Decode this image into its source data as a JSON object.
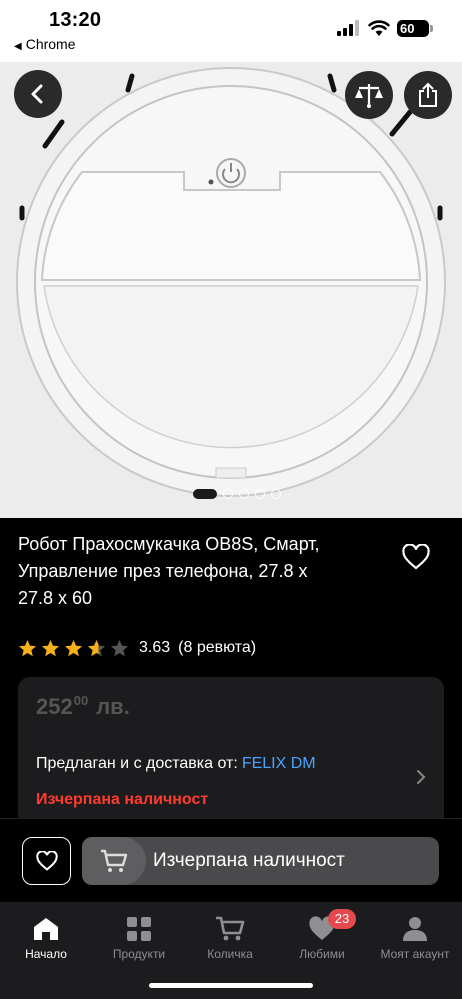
{
  "status_bar": {
    "time": "13:20",
    "back_app": "Chrome",
    "battery": "60"
  },
  "product": {
    "title": "Робот Прахосмукачка OB8S, Смарт, Управление през телефона, 27.8 x 27.8 x 60",
    "rating": "3.63",
    "rating_stars": 3.63,
    "reviews": "(8 ревюта)",
    "price_int": "252",
    "price_dec": "00",
    "currency": "лв.",
    "seller_prefix": "Предлаган и с доставка от:",
    "seller_name": "FELIX DM",
    "stock_status": "Изчерпана наличност",
    "image_count": 5,
    "image_active_index": 0
  },
  "actions": {
    "cart_label": "Изчерпана наличност"
  },
  "tabs": [
    {
      "label": "Начало",
      "icon": "home-icon",
      "active": true
    },
    {
      "label": "Продукти",
      "icon": "grid-icon",
      "active": false
    },
    {
      "label": "Количка",
      "icon": "cart-icon",
      "active": false
    },
    {
      "label": "Любими",
      "icon": "heart-icon",
      "active": false,
      "badge": "23"
    },
    {
      "label": "Моят акаунт",
      "icon": "account-icon",
      "active": false
    }
  ],
  "colors": {
    "background": "#000000",
    "card": "#1c1c1e",
    "stock_red": "#ff3b30",
    "link_blue": "#4aa3ff",
    "star": "#f5b01a",
    "badge": "#e5484d"
  }
}
